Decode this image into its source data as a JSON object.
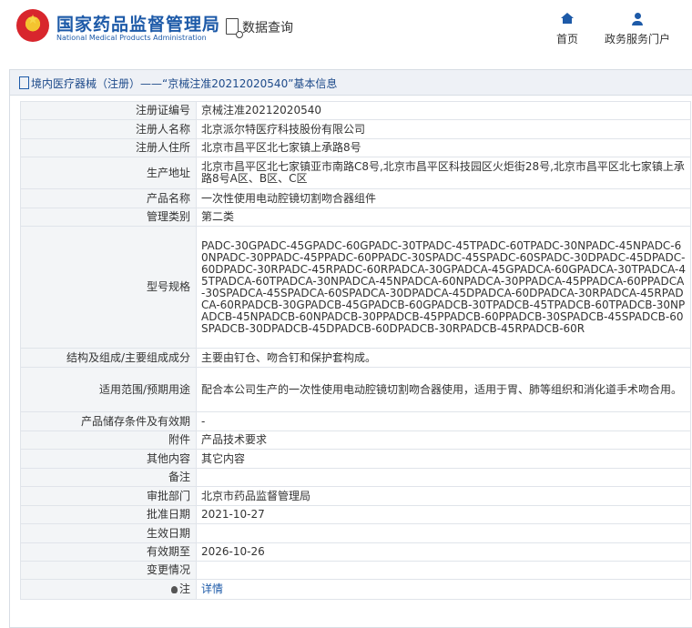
{
  "header": {
    "site_title": "国家药品监督管理局",
    "site_subtitle": "National Medical Products Administration",
    "data_query": "数据查询",
    "nav": [
      {
        "label": "首页",
        "icon": "home-icon"
      },
      {
        "label": "政务服务门户",
        "icon": "user-icon"
      }
    ]
  },
  "breadcrumb": "境内医疗器械（注册）——“京械注准20212020540”基本信息",
  "rows": [
    {
      "key": "注册证编号",
      "value": "京械注准20212020540"
    },
    {
      "key": "注册人名称",
      "value": "北京派尔特医疗科技股份有限公司"
    },
    {
      "key": "注册人住所",
      "value": "北京市昌平区北七家镇上承路8号"
    },
    {
      "key": "生产地址",
      "value": "北京市昌平区北七家镇亚市南路C8号,北京市昌平区科技园区火炬街28号,北京市昌平区北七家镇上承路8号A区、B区、C区"
    },
    {
      "key": "产品名称",
      "value": "一次性使用电动腔镜切割吻合器组件"
    },
    {
      "key": "管理类别",
      "value": "第二类"
    },
    {
      "key": "型号规格",
      "value": "PADC-30GPADC-45GPADC-60GPADC-30TPADC-45TPADC-60TPADC-30NPADC-45NPADC-60NPADC-30PPADC-45PPADC-60PPADC-30SPADC-45SPADC-60SPADC-30DPADC-45DPADC-60DPADC-30RPADC-45RPADC-60RPADCA-30GPADCA-45GPADCA-60GPADCA-30TPADCA-45TPADCA-60TPADCA-30NPADCA-45NPADCA-60NPADCA-30PPADCA-45PPADCA-60PPADCA-30SPADCA-45SPADCA-60SPADCA-30DPADCA-45DPADCA-60DPADCA-30RPADCA-45RPADCA-60RPADCB-30GPADCB-45GPADCB-60GPADCB-30TPADCB-45TPADCB-60TPADCB-30NPADCB-45NPADCB-60NPADCB-30PPADCB-45PPADCB-60PPADCB-30SPADCB-45SPADCB-60SPADCB-30DPADCB-45DPADCB-60DPADCB-30RPADCB-45RPADCB-60R"
    },
    {
      "key": "结构及组成/主要组成成分",
      "value": "主要由钉仓、吻合钉和保护套构成。"
    },
    {
      "key": "适用范围/预期用途",
      "value": "配合本公司生产的一次性使用电动腔镜切割吻合器使用，适用于胃、肺等组织和消化道手术吻合用。"
    },
    {
      "key": "产品储存条件及有效期",
      "value": "-"
    },
    {
      "key": "附件",
      "value": "产品技术要求"
    },
    {
      "key": "其他内容",
      "value": "其它内容"
    },
    {
      "key": "备注",
      "value": ""
    },
    {
      "key": "审批部门",
      "value": "北京市药品监督管理局"
    },
    {
      "key": "批准日期",
      "value": "2021-10-27"
    },
    {
      "key": "生效日期",
      "value": ""
    },
    {
      "key": "有效期至",
      "value": "2026-10-26"
    },
    {
      "key": "变更情况",
      "value": ""
    },
    {
      "key": "注",
      "value": "详情"
    }
  ]
}
